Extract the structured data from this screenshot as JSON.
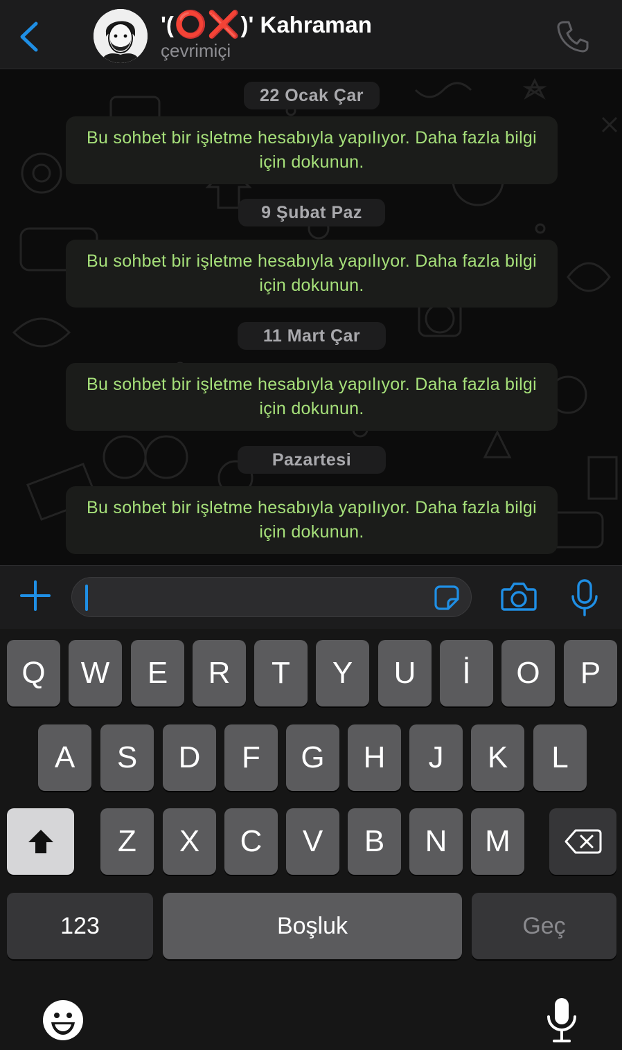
{
  "header": {
    "title_prefix": "'(",
    "title_symbols": "⭕❌",
    "title_suffix": ")' Kahraman",
    "status": "çevrimiçi",
    "back_icon": "chevron-left-icon",
    "call_icon": "phone-icon"
  },
  "chat": {
    "items": [
      {
        "date": "22 Ocak Çar",
        "notice": "Bu sohbet bir işletme hesabıyla yapılıyor. Daha fazla bilgi için dokunun."
      },
      {
        "date": "9 Şubat Paz",
        "notice": "Bu sohbet bir işletme hesabıyla yapılıyor. Daha fazla bilgi için dokunun."
      },
      {
        "date": "11 Mart Çar",
        "notice": "Bu sohbet bir işletme hesabıyla yapılıyor. Daha fazla bilgi için dokunun."
      },
      {
        "date": "Pazartesi",
        "notice": "Bu sohbet bir işletme hesabıyla yapılıyor. Daha fazla bilgi için dokunun."
      }
    ]
  },
  "input_bar": {
    "message_placeholder": "",
    "icons": [
      "plus-icon",
      "sticker-icon",
      "camera-icon",
      "microphone-icon"
    ]
  },
  "keyboard": {
    "row1": [
      "Q",
      "W",
      "E",
      "R",
      "T",
      "Y",
      "U",
      "İ",
      "O",
      "P"
    ],
    "row2": [
      "A",
      "S",
      "D",
      "F",
      "G",
      "H",
      "J",
      "K",
      "L"
    ],
    "row3": [
      "Z",
      "X",
      "C",
      "V",
      "B",
      "N",
      "M"
    ],
    "numbers_key": "123",
    "space_key": "Boşluk",
    "return_key": "Geç",
    "icons": [
      "shift-icon",
      "backspace-icon",
      "emoji-icon",
      "dictation-icon"
    ]
  },
  "colors": {
    "accent": "#1f8fe5",
    "notice_text": "#a6e07a",
    "header_bg": "#1c1c1d",
    "key_bg": "#5b5b5d",
    "function_key_bg": "#363638"
  }
}
